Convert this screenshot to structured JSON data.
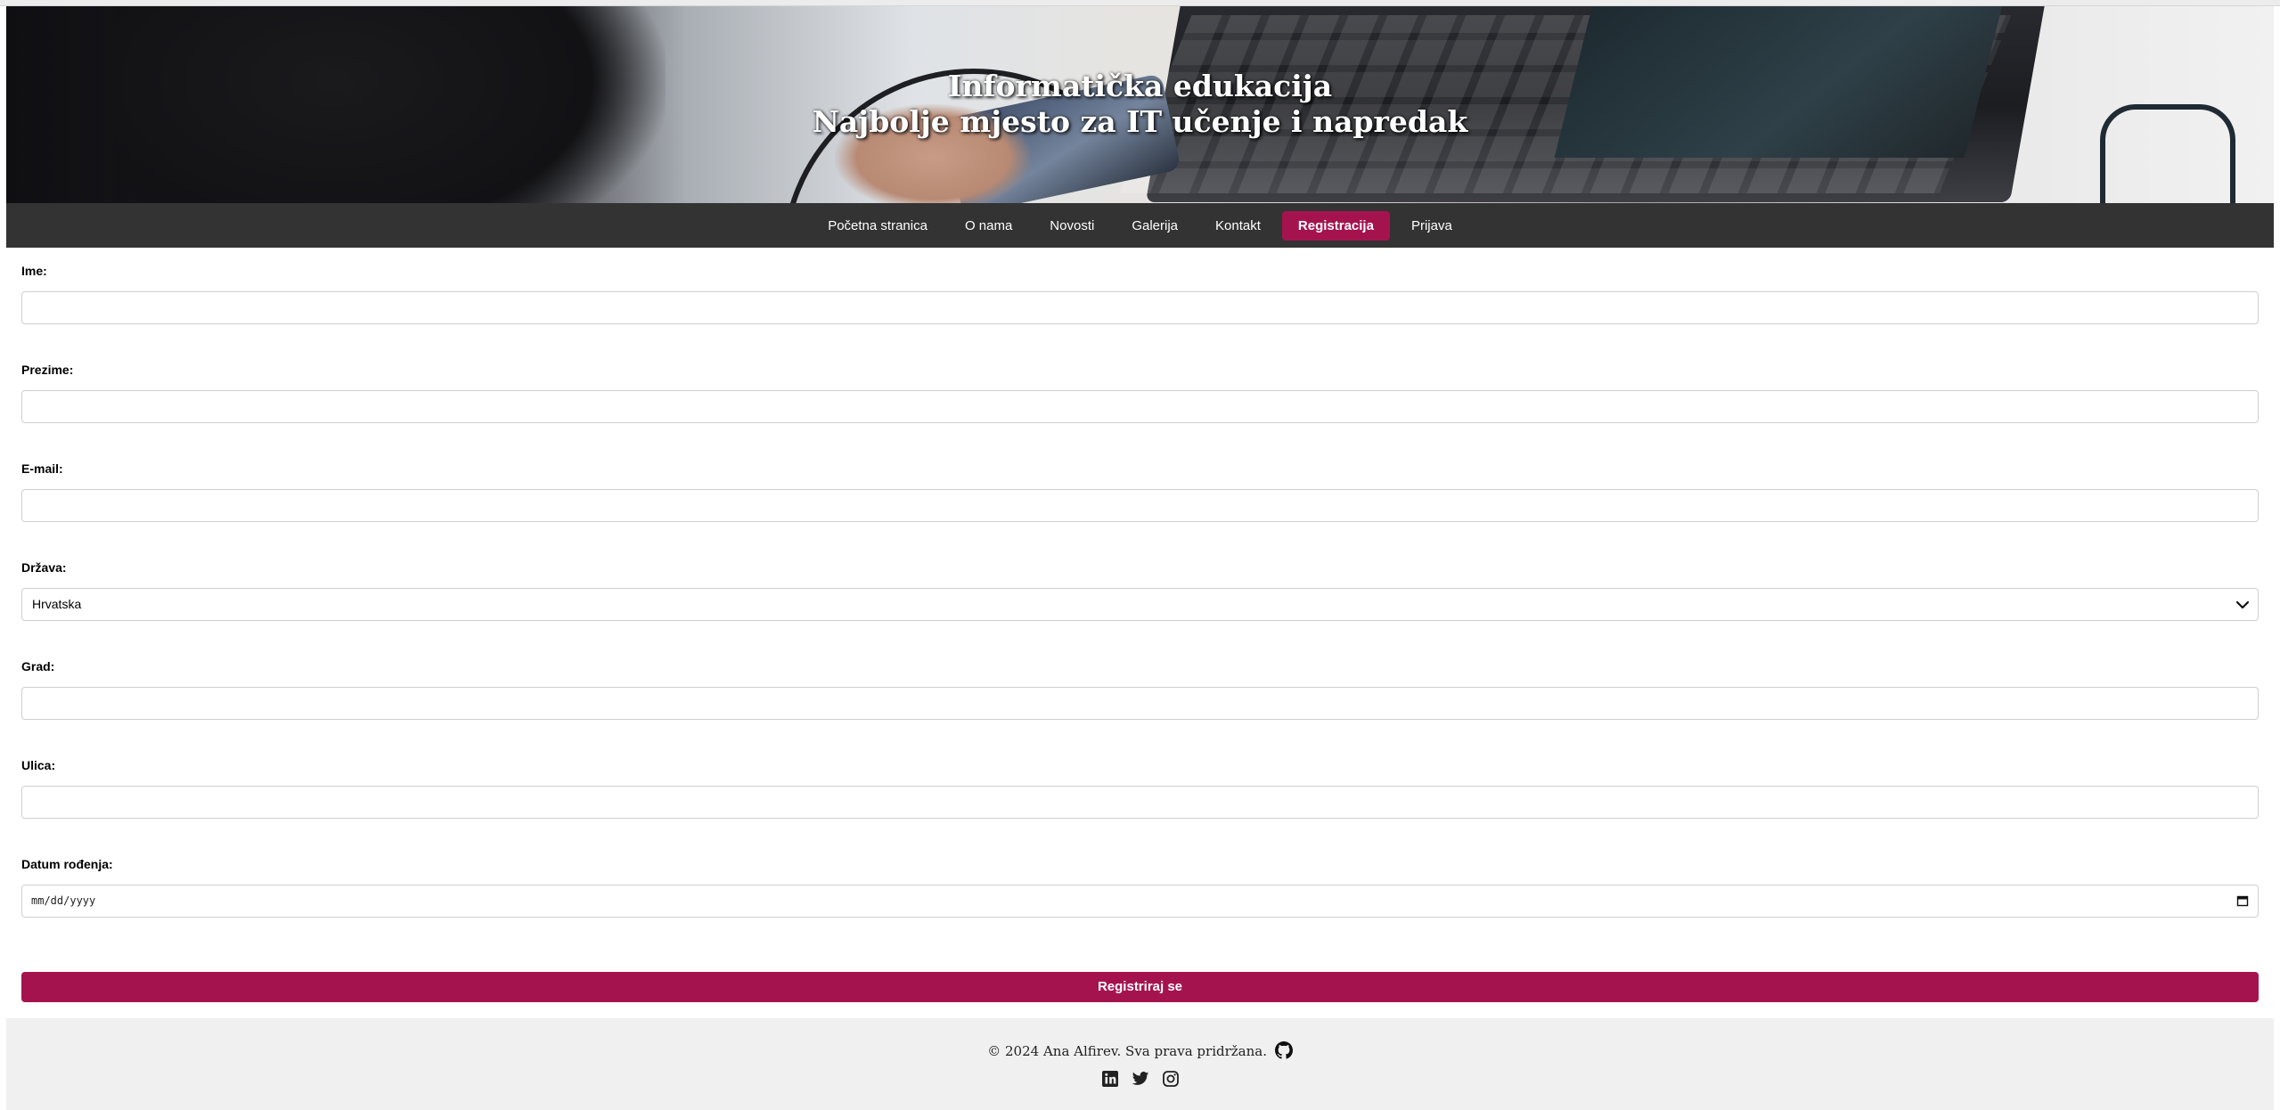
{
  "header": {
    "title": "Informatička edukacija",
    "subtitle": "Najbolje mjesto za IT učenje i napredak"
  },
  "nav": {
    "items": [
      {
        "label": "Početna stranica",
        "active": false
      },
      {
        "label": "O nama",
        "active": false
      },
      {
        "label": "Novosti",
        "active": false
      },
      {
        "label": "Galerija",
        "active": false
      },
      {
        "label": "Kontakt",
        "active": false
      },
      {
        "label": "Registracija",
        "active": true
      },
      {
        "label": "Prijava",
        "active": false
      }
    ]
  },
  "form": {
    "first_name_label": "Ime:",
    "first_name_value": "",
    "last_name_label": "Prezime:",
    "last_name_value": "",
    "email_label": "E-mail:",
    "email_value": "",
    "country_label": "Država:",
    "country_value": "Hrvatska",
    "city_label": "Grad:",
    "city_value": "",
    "street_label": "Ulica:",
    "street_value": "",
    "birthdate_label": "Datum rođenja:",
    "birthdate_placeholder": "mm/dd/yyyy",
    "submit_label": "Registriraj se"
  },
  "footer": {
    "copyright": "© 2024 Ana Alfirev. Sva prava pridržana.",
    "social_icons": [
      "github-icon",
      "linkedin-icon",
      "twitter-icon",
      "instagram-icon"
    ]
  },
  "colors": {
    "accent": "#a5134f",
    "nav_bg": "#333333",
    "footer_bg": "#f0f0f0"
  }
}
